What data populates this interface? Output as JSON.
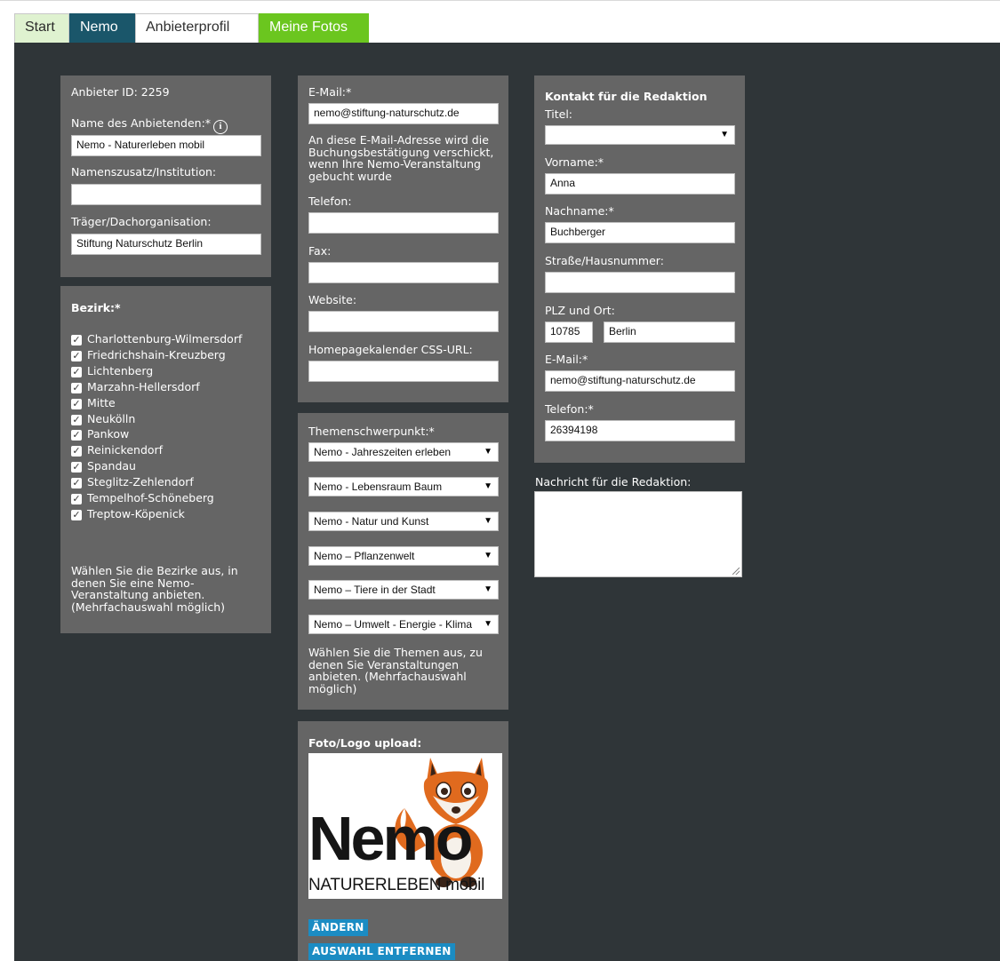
{
  "tabs": [
    {
      "label": "Start"
    },
    {
      "label": "Nemo"
    },
    {
      "label": "Anbieterprofil"
    },
    {
      "label": "Meine Fotos"
    }
  ],
  "anbieter": {
    "id_label": "Anbieter ID: 2259",
    "name_label": "Name des Anbietenden:*",
    "name_value": "Nemo - Naturerleben mobil",
    "zusatz_label": "Namenszusatz/Institution:",
    "zusatz_value": "",
    "traeger_label": "Träger/Dachorganisation:",
    "traeger_value": "Stiftung Naturschutz Berlin"
  },
  "bezirk": {
    "label": "Bezirk:*",
    "items": [
      "Charlottenburg-Wilmersdorf",
      "Friedrichshain-Kreuzberg",
      "Lichtenberg",
      "Marzahn-Hellersdorf",
      "Mitte",
      "Neukölln",
      "Pankow",
      "Reinickendorf",
      "Spandau",
      "Steglitz-Zehlendorf",
      "Tempelhof-Schöneberg",
      "Treptow-Köpenick"
    ],
    "hint": "Wählen Sie die Bezirke aus, in denen Sie eine Nemo-Veranstaltung anbieten. (Mehrfachauswahl möglich)"
  },
  "contact": {
    "email_label": "E-Mail:*",
    "email_value": "nemo@stiftung-naturschutz.de",
    "email_hint": "An diese E-Mail-Adresse wird die Buchungsbestätigung verschickt, wenn Ihre Nemo-Veranstaltung gebucht wurde",
    "telefon_label": "Telefon:",
    "telefon_value": "",
    "fax_label": "Fax:",
    "fax_value": "",
    "website_label": "Website:",
    "website_value": "",
    "css_label": "Homepagekalender CSS-URL:",
    "css_value": ""
  },
  "themen": {
    "label": "Themenschwerpunkt:*",
    "selects": [
      "Nemo - Jahreszeiten erleben",
      "Nemo - Lebensraum Baum",
      "Nemo - Natur und Kunst",
      "Nemo – Pflanzenwelt",
      "Nemo – Tiere in der Stadt",
      "Nemo – Umwelt - Energie - Klima"
    ],
    "hint": "Wählen Sie die Themen aus, zu denen Sie Veranstaltungen anbieten. (Mehrfachauswahl möglich)"
  },
  "upload": {
    "label": "Foto/Logo upload:",
    "logo_word": "Nemo",
    "logo_tagline_bold": "NATURERLEBEN",
    "logo_tagline_light": "mobil",
    "change_button": "ÄNDERN",
    "remove_button": "AUSWAHL ENTFERNEN"
  },
  "redaktion": {
    "heading": "Kontakt für die Redaktion",
    "titel_label": "Titel:",
    "titel_value": "",
    "vorname_label": "Vorname:*",
    "vorname_value": "Anna",
    "nachname_label": "Nachname:*",
    "nachname_value": "Buchberger",
    "strasse_label": "Straße/Hausnummer:",
    "strasse_value": "",
    "plz_label": "PLZ und Ort:",
    "plz_value": "10785",
    "ort_value": "Berlin",
    "email_label": "E-Mail:*",
    "email_value": "nemo@stiftung-naturschutz.de",
    "telefon_label": "Telefon:*",
    "telefon_value": "26394198",
    "nachricht_label": "Nachricht für die Redaktion:"
  },
  "icons": {
    "help": "info-circle-icon",
    "check": "checkbox-checked-icon",
    "dropdown": "dropdown-arrow-icon"
  },
  "colors": {
    "background": "#2f3538",
    "panel": "#656565",
    "tab_nemo": "#1a566a",
    "tab_fotos": "#6bc61f",
    "tab_start": "#dff2d0",
    "button": "#1b8cc3"
  }
}
